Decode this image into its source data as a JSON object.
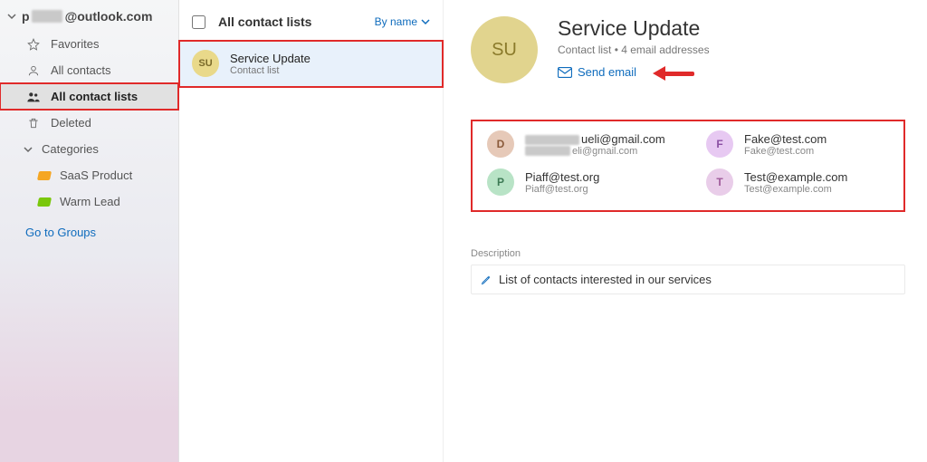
{
  "sidebar": {
    "account_suffix": "@outlook.com",
    "favorites": "Favorites",
    "all_contacts": "All contacts",
    "all_contact_lists": "All contact lists",
    "deleted": "Deleted",
    "categories_label": "Categories",
    "categories": [
      {
        "label": "SaaS Product",
        "color": "#f5a623"
      },
      {
        "label": "Warm Lead",
        "color": "#7ac70c"
      }
    ],
    "groups_link": "Go to Groups"
  },
  "list": {
    "header": "All contact lists",
    "sort_label": "By name",
    "items": [
      {
        "initials": "SU",
        "name": "Service Update",
        "subtitle": "Contact list"
      }
    ]
  },
  "detail": {
    "initials": "SU",
    "title": "Service Update",
    "subtitle": "Contact list • 4 email addresses",
    "send_email": "Send email",
    "members": [
      {
        "initial": "D",
        "name_suffix": "ueli@gmail.com",
        "email_suffix": "eli@gmail.com",
        "avatar_bg": "#e6c9b8",
        "avatar_fg": "#8a5a3a",
        "masked": true
      },
      {
        "initial": "F",
        "name": "Fake@test.com",
        "email": "Fake@test.com",
        "avatar_bg": "#e7c9f2",
        "avatar_fg": "#8a4fa3",
        "masked": false
      },
      {
        "initial": "P",
        "name": "Piaff@test.org",
        "email": "Piaff@test.org",
        "avatar_bg": "#b8e3c6",
        "avatar_fg": "#3d7a55",
        "masked": false
      },
      {
        "initial": "T",
        "name": "Test@example.com",
        "email": "Test@example.com",
        "avatar_bg": "#e9cde9",
        "avatar_fg": "#a05a9a",
        "masked": false
      }
    ],
    "description_label": "Description",
    "description_text": "List of contacts interested in our services"
  }
}
